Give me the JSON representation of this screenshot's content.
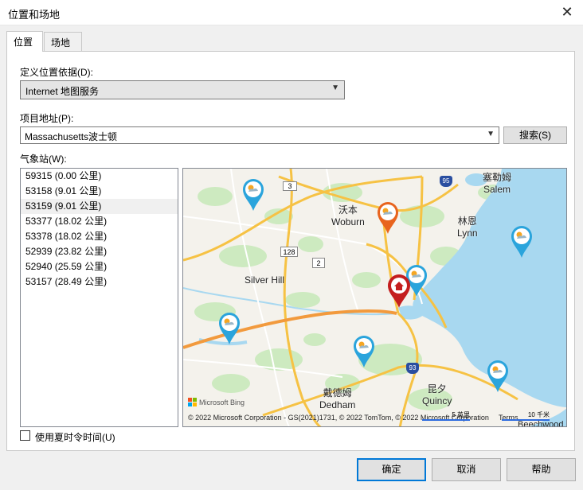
{
  "window": {
    "title": "位置和场地",
    "close_glyph": "✕"
  },
  "tabs": [
    {
      "label": "位置"
    },
    {
      "label": "场地"
    }
  ],
  "location_basis": {
    "label": "定义位置依据(D):",
    "value": "Internet 地图服务"
  },
  "project_address": {
    "label": "项目地址(P):",
    "value": "Massachusetts波士顿",
    "search_label": "搜索(S)"
  },
  "weather_stations": {
    "label": "气象站(W):",
    "items": [
      "59315 (0.00 公里)",
      "53158 (9.01 公里)",
      "53159 (9.01 公里)",
      "53377 (18.02 公里)",
      "53378 (18.02 公里)",
      "52939 (23.82 公里)",
      "52940 (25.59 公里)",
      "53157 (28.49 公里)"
    ],
    "selected_index": 2
  },
  "map": {
    "places": {
      "salem_zh": "塞勒姆",
      "salem_en": "Salem",
      "woburn_zh": "沃本",
      "woburn_en": "Woburn",
      "lynn_zh": "林恩",
      "lynn_en": "Lynn",
      "silverhill": "Silver Hill",
      "dedham_zh": "戴德姆",
      "dedham_en": "Dedham",
      "quincy_zh": "昆夕",
      "quincy_en": "Quincy",
      "beechwood": "Beechwood"
    },
    "road_shields": {
      "r3": "3",
      "r128": "128",
      "r2": "2",
      "i95": "95",
      "i93": "93"
    },
    "logo_text": "Microsoft Bing",
    "attribution": "© 2022 Microsoft Corporation - GS(2021)1731, © 2022 TomTom, © 2022 Microsoft Corporation",
    "terms": "Terms",
    "scale_mi": "5 英里",
    "scale_km": "10 千米",
    "colors": {
      "water": "#a8d8f0",
      "land": "#f4f2ec",
      "park": "#cdeac0",
      "highway": "#f6c244",
      "home_pin": "#c41e1e",
      "selected_pin": "#e8641e",
      "station_pin": "#2aa4dc"
    }
  },
  "dst_checkbox": {
    "label": "使用夏时令时间(U)",
    "checked": false
  },
  "buttons": {
    "ok": "确定",
    "cancel": "取消",
    "help": "帮助"
  }
}
